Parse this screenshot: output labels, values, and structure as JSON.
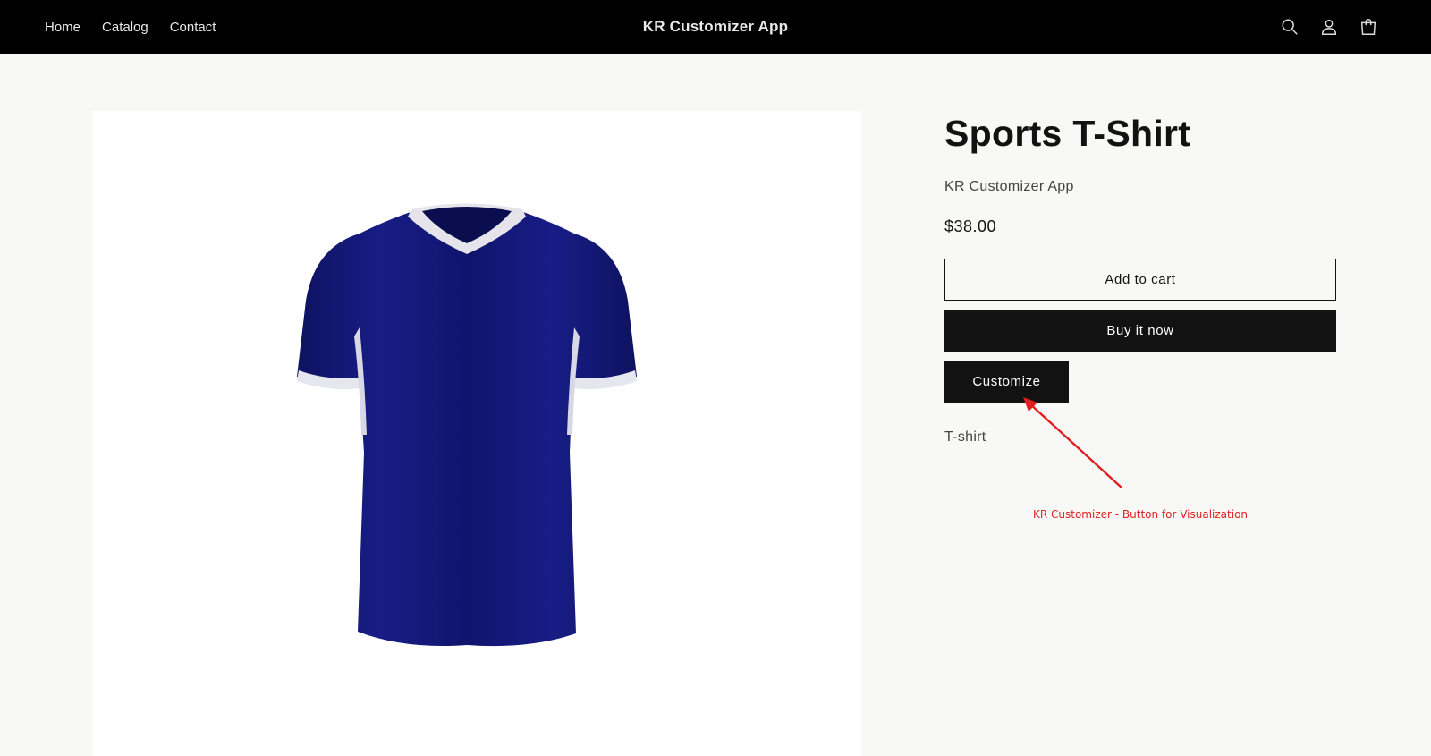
{
  "header": {
    "nav": [
      "Home",
      "Catalog",
      "Contact"
    ],
    "brand": "KR Customizer App",
    "icons": [
      "search-icon",
      "account-icon",
      "cart-icon"
    ]
  },
  "product": {
    "title": "Sports T-Shirt",
    "vendor": "KR Customizer App",
    "price": "$38.00",
    "add_to_cart_label": "Add to cart",
    "buy_now_label": "Buy it now",
    "customize_label": "Customize",
    "description": "T-shirt",
    "image": {
      "subject": "navy blue sports t-shirt with white collar and sleeve trim"
    }
  },
  "annotation": {
    "text": "KR Customizer - Button for Visualization",
    "color": "#e02020"
  },
  "colors": {
    "header_bg": "#000000",
    "page_bg": "#f8f8f6",
    "button_dark": "#121212",
    "shirt_navy": "#151a7a"
  }
}
